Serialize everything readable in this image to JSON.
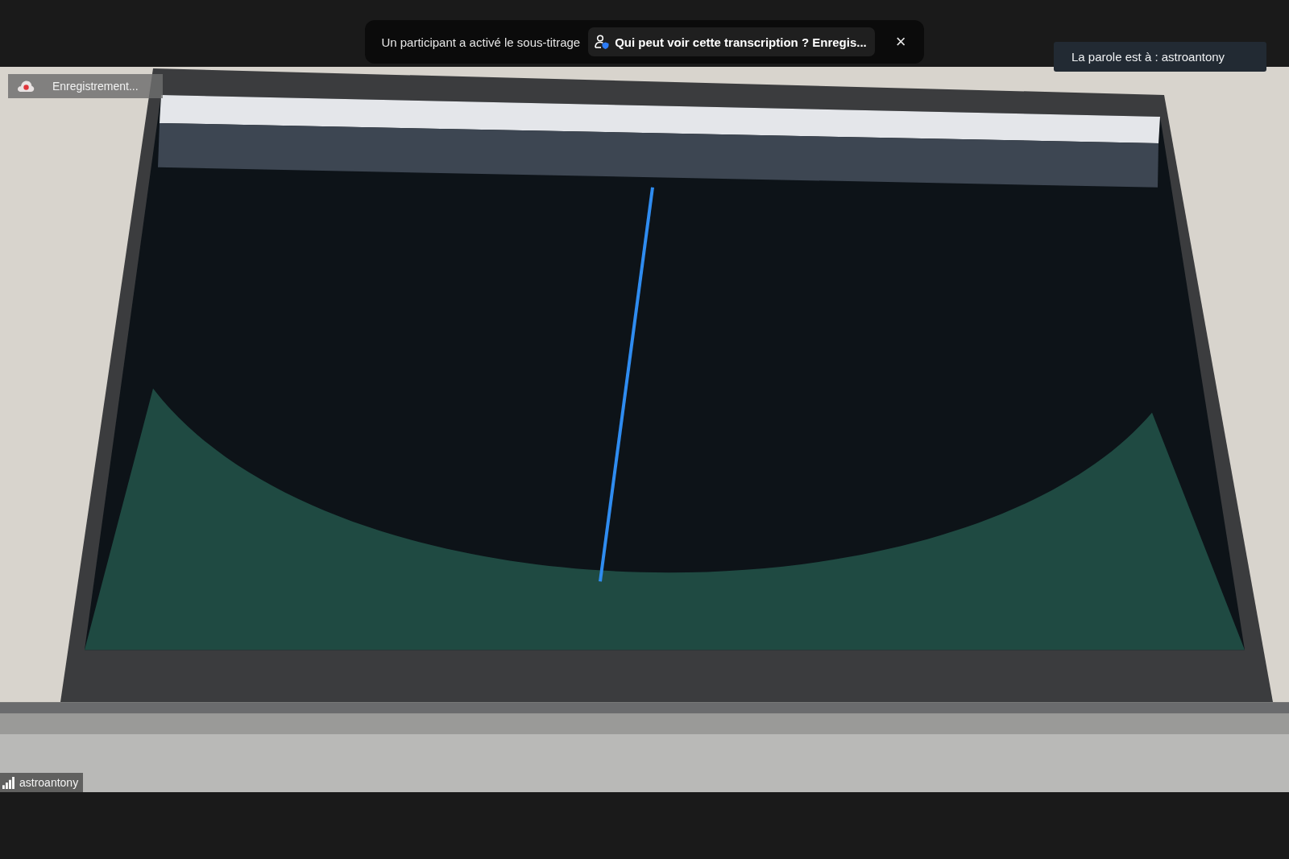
{
  "caption_banner": {
    "message": "Un participant a activé le sous-titrage",
    "link": "Qui peut voir cette transcription ? Enregis...",
    "close": "×"
  },
  "speaker_indicator": {
    "text": "La parole est à : astroantony"
  },
  "recording_indicator": {
    "label": "Enregistrement..."
  },
  "video": {
    "participant_name": "astroantony"
  }
}
